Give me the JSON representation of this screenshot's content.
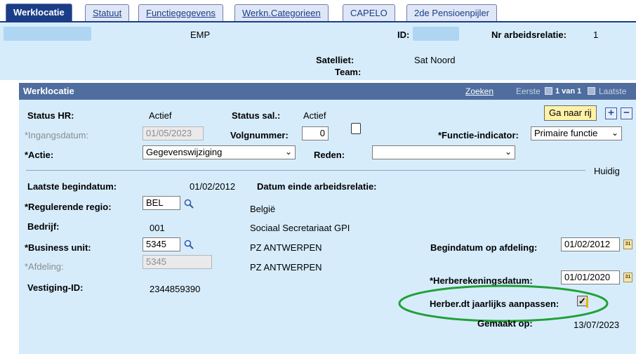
{
  "tabs": [
    {
      "label": "Werklocatie",
      "active": true
    },
    {
      "label": "Statuut"
    },
    {
      "label": "Functiegegevens"
    },
    {
      "label": "Werkn.Categorieen"
    },
    {
      "label": "CAPELO"
    },
    {
      "label": "2de Pensioenpijler"
    }
  ],
  "header": {
    "emp_label": "EMP",
    "id_label": "ID:",
    "nr_label": "Nr arbeidsrelatie:",
    "nr_value": "1",
    "satelliet_label": "Satelliet:",
    "satelliet_value": "Sat Noord",
    "team_label": "Team:"
  },
  "panel": {
    "title": "Werklocatie",
    "zoeken": "Zoeken",
    "eerste": "Eerste",
    "pager": "1 van 1",
    "laatste": "Laatste"
  },
  "form": {
    "status_hr_label": "Status HR:",
    "status_hr_value": "Actief",
    "status_sal_label": "Status sal.:",
    "status_sal_value": "Actief",
    "goto_button": "Ga naar rij",
    "ingangsdatum_label": "*Ingangsdatum:",
    "ingangsdatum_value": "01/05/2023",
    "volgnummer_label": "Volgnummer:",
    "volgnummer_value": "0",
    "functie_indicator_label": "*Functie-indicator:",
    "functie_indicator_value": "Primaire functie",
    "actie_label": "*Actie:",
    "actie_value": "Gegevenswijziging",
    "reden_label": "Reden:",
    "reden_value": "",
    "huidig": "Huidig",
    "laatste_begindatum_label": "Laatste begindatum:",
    "laatste_begindatum_value": "01/02/2012",
    "datum_einde_label": "Datum einde arbeidsrelatie:",
    "regio_label": "*Regulerende regio:",
    "regio_value": "BEL",
    "regio_desc": "België",
    "bedrijf_label": "Bedrijf:",
    "bedrijf_value": "001",
    "bedrijf_desc": "Sociaal Secretariaat GPI",
    "bu_label": "*Business unit:",
    "bu_value": "5345",
    "bu_desc": "PZ ANTWERPEN",
    "begindatum_afdeling_label": "Begindatum op afdeling:",
    "begindatum_afdeling_value": "01/02/2012",
    "afdeling_label": "*Afdeling:",
    "afdeling_value": "5345",
    "afdeling_desc": "PZ ANTWERPEN",
    "vestiging_label": "Vestiging-ID:",
    "vestiging_value": "2344859390",
    "herberekening_label": "*Herberekeningsdatum:",
    "herberekening_value": "01/01/2020",
    "herber_jaarlijks_label": "Herber.dt jaarlijks aanpassen:",
    "herber_jaarlijks_checked": true,
    "gemaakt_label": "Gemaakt op:",
    "gemaakt_value": "13/07/2023"
  },
  "colors": {
    "tab_active": "#1b3d87",
    "header_bg": "#d6ecfb",
    "panel_bar": "#4f6e9f",
    "highlight_ellipse": "#20a038"
  }
}
